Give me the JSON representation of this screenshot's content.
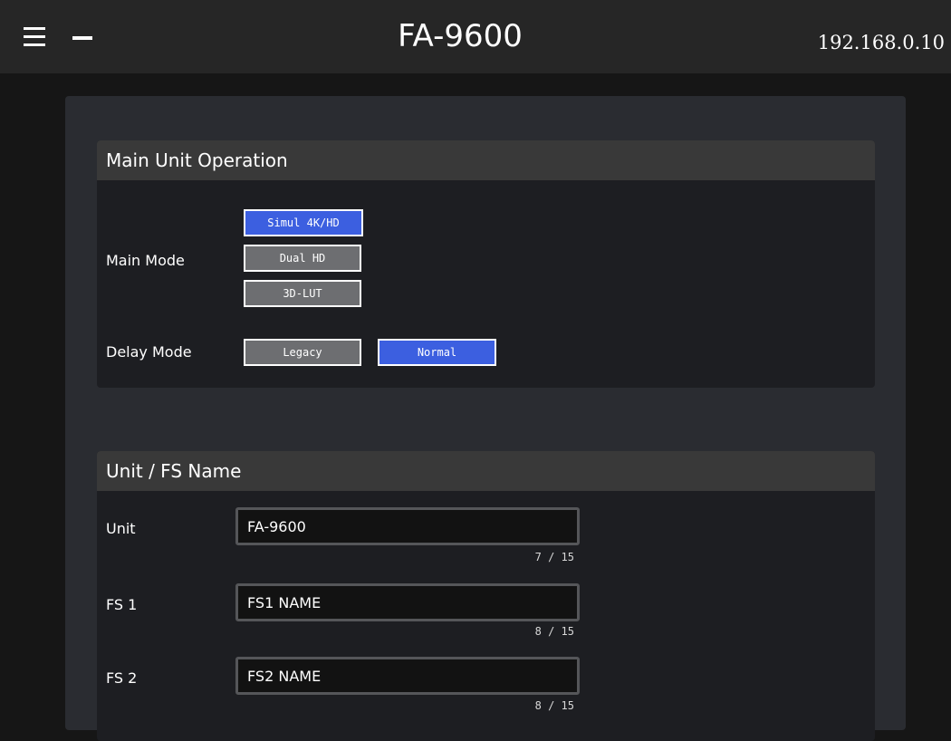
{
  "header": {
    "title": "FA-9600",
    "ip_address": "192.168.0.10",
    "menu_icon": "hamburger-menu-icon",
    "minimize_icon": "minus-icon"
  },
  "main_unit_operation": {
    "title": "Main Unit Operation",
    "main_mode": {
      "label": "Main Mode",
      "options": [
        {
          "label": "Simul 4K/HD",
          "selected": true
        },
        {
          "label": "Dual HD",
          "selected": false
        },
        {
          "label": "3D-LUT",
          "selected": false
        }
      ]
    },
    "delay_mode": {
      "label": "Delay Mode",
      "options": [
        {
          "label": "Legacy",
          "selected": false
        },
        {
          "label": "Normal",
          "selected": true
        }
      ]
    }
  },
  "unit_fs_name": {
    "title": "Unit / FS Name",
    "fields": [
      {
        "label": "Unit",
        "value": "FA-9600",
        "count": "7 / 15"
      },
      {
        "label": "FS 1",
        "value": "FS1 NAME",
        "count": "8 / 15"
      },
      {
        "label": "FS 2",
        "value": "FS2 NAME",
        "count": "8 / 15"
      }
    ]
  },
  "colors": {
    "selected": "#3c5fe0",
    "unselected": "#6d6e71",
    "topbar": "#262626",
    "panel": "#2a2c31",
    "section_header": "#393939"
  }
}
